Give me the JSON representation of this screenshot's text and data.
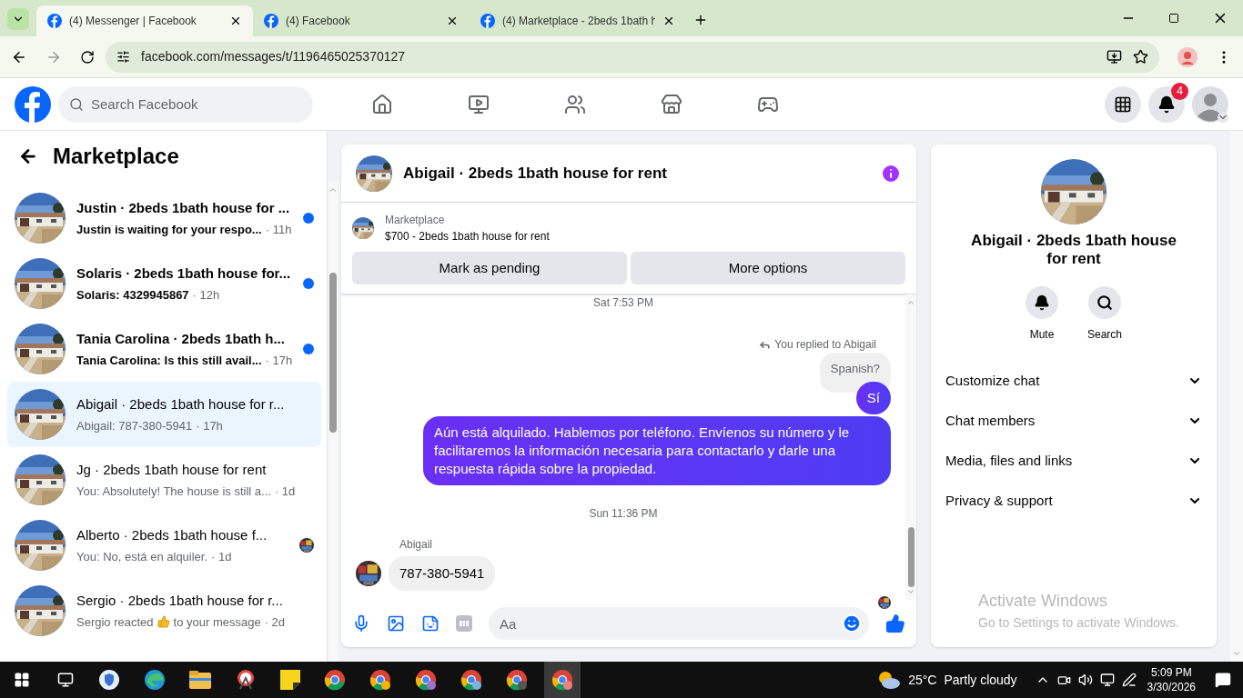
{
  "browser": {
    "tabs": [
      {
        "title": "(4) Messenger | Facebook",
        "selected": true
      },
      {
        "title": "(4) Facebook",
        "selected": false
      },
      {
        "title": "(4) Marketplace - 2beds 1bath h",
        "selected": false
      }
    ],
    "url": "facebook.com/messages/t/1196465025370127"
  },
  "topbar": {
    "search": {
      "placeholder": "Search Facebook"
    },
    "notifications": "4"
  },
  "sidebar": {
    "title": "Marketplace",
    "conversations": [
      {
        "name": "Justin · 2beds 1bath house for ...",
        "preview": "Justin is waiting for your respo...",
        "time": "· 11h",
        "unread": true,
        "selected": false,
        "seen": false
      },
      {
        "name": "Solaris · 2beds 1bath house for...",
        "preview": "Solaris: 4329945867",
        "time": "· 12h",
        "unread": true,
        "selected": false,
        "seen": false
      },
      {
        "name": "Tania Carolina · 2beds 1bath h...",
        "preview": "Tania Carolina: Is this still avail...",
        "time": "· 17h",
        "unread": true,
        "selected": false,
        "seen": false
      },
      {
        "name": "Abigail · 2beds 1bath house for r...",
        "preview": "Abigail: 787-380-5941",
        "time": "· 17h",
        "unread": false,
        "selected": true,
        "seen": false
      },
      {
        "name": "Jg · 2beds 1bath house for rent",
        "preview": "You: Absolutely! The house is still a...",
        "time": "· 1d",
        "unread": false,
        "selected": false,
        "seen": false
      },
      {
        "name": "Alberto · 2beds 1bath house f...",
        "preview": "You: No, está en alquiler.",
        "time": "· 1d",
        "unread": false,
        "selected": false,
        "seen": true
      },
      {
        "name": "Sergio · 2beds 1bath house for r...",
        "preview": "Sergio reacted",
        "preview_end": "to your message",
        "time": "· 2d",
        "unread": false,
        "selected": false,
        "seen": false,
        "kind": "reaction"
      }
    ]
  },
  "chat": {
    "title": "Abigail · 2beds 1bath house for rent",
    "listing": {
      "label": "Marketplace",
      "title": "$700 - 2beds 1bath house for rent"
    },
    "buttons": [
      "Mark as pending",
      "More options"
    ],
    "messages": [
      {
        "kind": "time",
        "text": "Sat 7:53 PM"
      },
      {
        "kind": "reply_note",
        "text": "You replied to Abigail"
      },
      {
        "kind": "quoted",
        "text": "Spanish?"
      },
      {
        "kind": "outgoing",
        "text": "Sí"
      },
      {
        "kind": "outgoing",
        "text": "Aún está alquilado. Hablemos por teléfono. Envíenos su número y le facilitaremos la información necesaria para contactarlo y darle una respuesta rápida sobre la propiedad."
      },
      {
        "kind": "time",
        "text": "Sun 11:36 PM"
      },
      {
        "kind": "incoming",
        "sender": "Abigail",
        "text": "787-380-5941"
      }
    ],
    "composer": {
      "placeholder": "Aa"
    }
  },
  "details": {
    "title": "Abigail · 2beds 1bath house for rent",
    "actions": [
      {
        "label": "Mute",
        "kind": "bell"
      },
      {
        "label": "Search",
        "kind": "search"
      }
    ],
    "sections": [
      {
        "label": "Customize chat",
        "expanded": false
      },
      {
        "label": "Chat members",
        "expanded": false
      },
      {
        "label": "Media, files and links",
        "expanded": false
      },
      {
        "label": "Privacy & support",
        "expanded": false
      }
    ]
  },
  "activation": {
    "title": "Activate Windows",
    "subtitle": "Go to Settings to activate Windows."
  },
  "taskbar": {
    "temperature": "25°C",
    "weather": "Partly cloudy",
    "time": "5:09 PM",
    "date": "3/30/2026"
  }
}
